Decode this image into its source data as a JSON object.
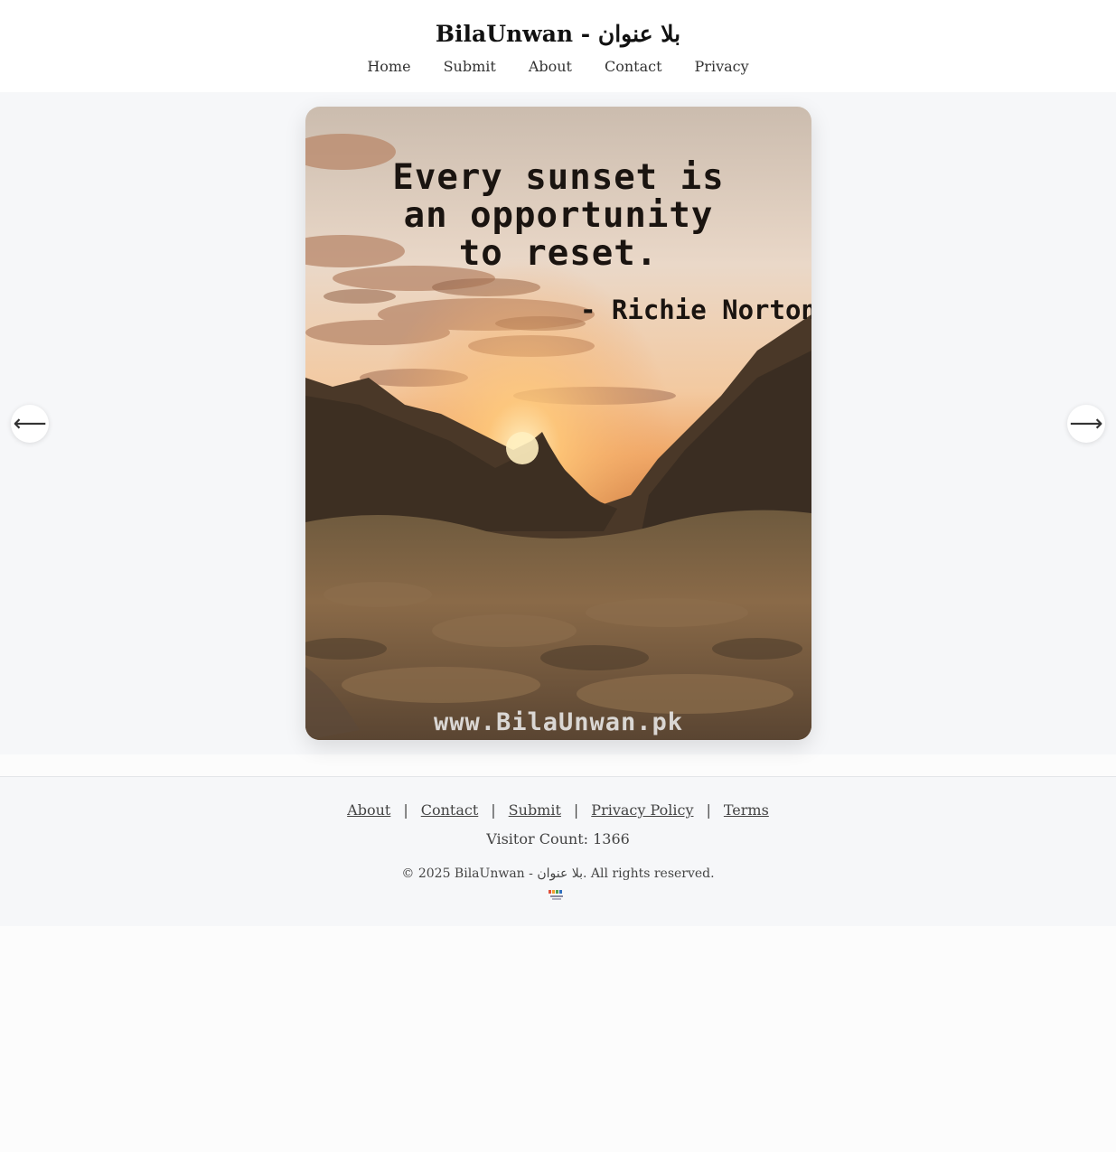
{
  "header": {
    "site_title": "BilaUnwan - بلا عنوان",
    "nav": [
      {
        "label": "Home"
      },
      {
        "label": "Submit"
      },
      {
        "label": "About"
      },
      {
        "label": "Contact"
      },
      {
        "label": "Privacy"
      }
    ]
  },
  "slider": {
    "quote": "Every sunset is\nan opportunity\nto reset.",
    "author": "- Richie Norton",
    "watermark": "www.BilaUnwan.pk",
    "prev_icon": "arrow-left-icon",
    "next_icon": "arrow-right-icon",
    "prev_glyph": "⟵",
    "next_glyph": "⟶"
  },
  "footer": {
    "links": [
      {
        "label": "About"
      },
      {
        "label": "Contact"
      },
      {
        "label": "Submit"
      },
      {
        "label": "Privacy Policy"
      },
      {
        "label": "Terms"
      }
    ],
    "separator": "|",
    "visitor_count": "Visitor Count: 1366",
    "copyright": "© 2025 BilaUnwan - بلا عنوان. All rights reserved."
  },
  "colors": {
    "header_bg": "#ffffff",
    "slider_bg": "#f6f7f9",
    "footer_bg": "#f6f7f9",
    "text": "#333333"
  }
}
